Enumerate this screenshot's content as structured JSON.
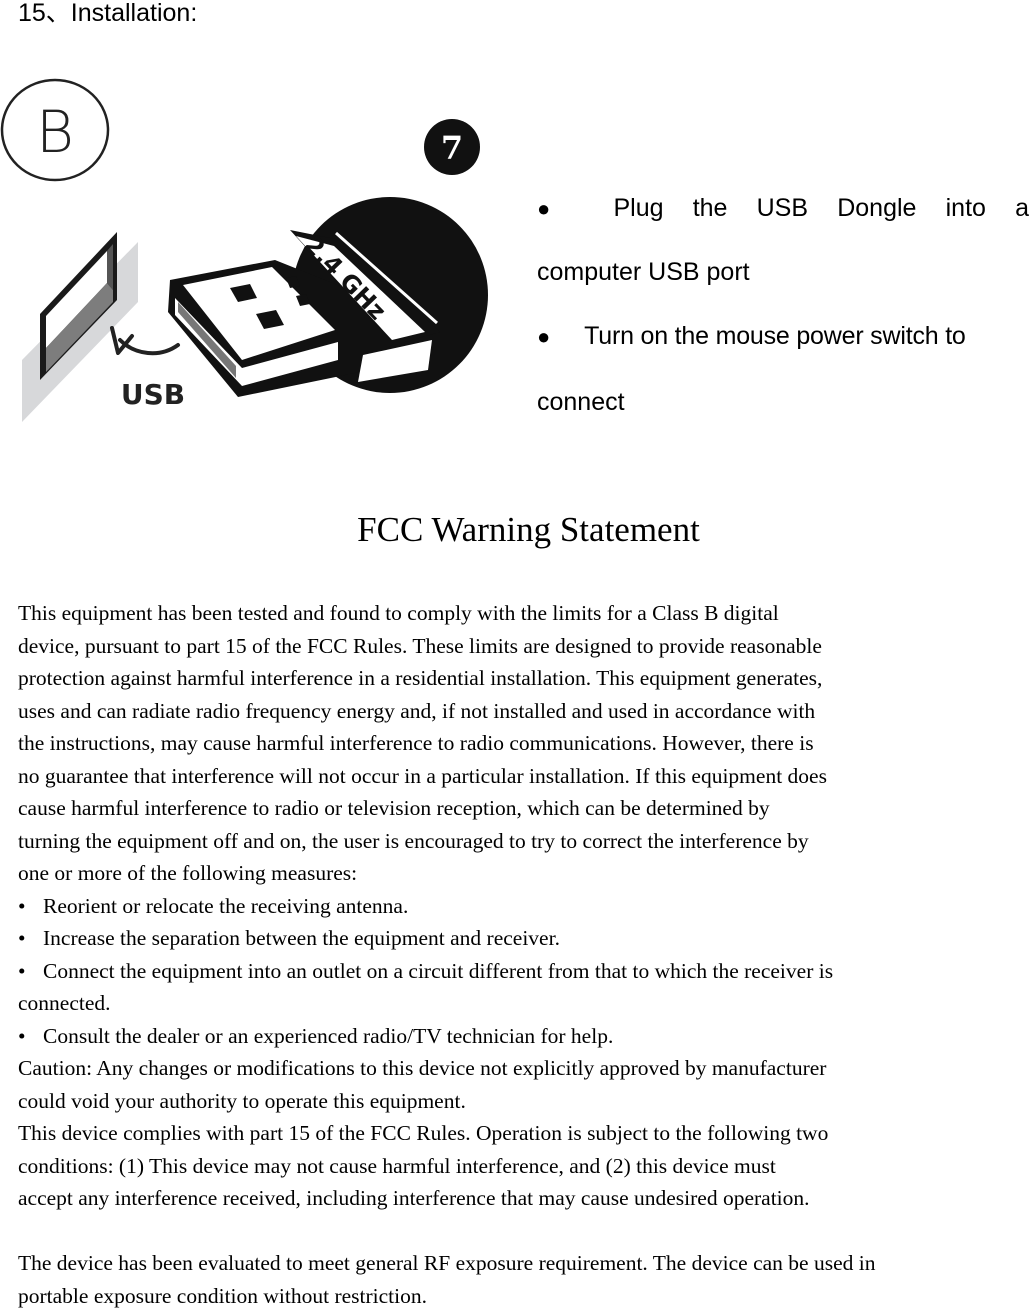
{
  "section": {
    "title": "15、Installation:"
  },
  "illustration": {
    "badge_letter": "B",
    "step_number": "7",
    "port_label": "USB",
    "dongle_label": "2.4 GHz"
  },
  "steps": [
    {
      "bullet": "●",
      "line1_words": [
        "Plug",
        "the",
        "USB",
        "Dongle",
        "into",
        "a"
      ],
      "line2": "computer USB port"
    },
    {
      "bullet": "●",
      "line1": "Turn on the mouse power switch to",
      "line2": "connect"
    }
  ],
  "fcc": {
    "heading": "FCC Warning Statement",
    "paragraph_lines": [
      "This equipment has been tested and found to comply with the limits for a Class B digital",
      "device, pursuant to part 15 of the FCC Rules. These limits are designed to provide reasonable",
      "protection against harmful interference in a residential installation. This equipment generates,",
      "uses and can radiate radio frequency energy and, if not installed and used in accordance with",
      "the instructions, may cause harmful interference to radio communications. However, there is",
      "no guarantee that interference will not occur in a particular installation. If this equipment does",
      "cause harmful interference to radio or television reception, which can be determined by",
      "turning the equipment off and on, the user is encouraged to try to correct the interference by",
      "one or more of the following measures:"
    ],
    "bullet_symbol": "•",
    "measures": [
      "Reorient or relocate the receiving antenna.",
      "Increase the separation between the equipment and receiver.",
      "Connect the equipment into an outlet on a circuit different from that to which the receiver is",
      "Consult the dealer or an experienced radio/TV technician for help."
    ],
    "measure3_continuation": "connected.",
    "caution_lines": [
      "Caution: Any changes or modifications to this device not explicitly approved by manufacturer",
      "could void your authority to operate this equipment."
    ],
    "compliance_lines": [
      "This device complies with part 15 of the FCC Rules. Operation is subject to the following two",
      "conditions: (1) This device may not cause harmful interference, and (2) this device must",
      "accept any interference received, including interference that may cause undesired operation."
    ],
    "rf_lines": [
      "The device has been evaluated to meet general RF exposure requirement. The device can be used in",
      "portable exposure condition without restriction."
    ]
  }
}
